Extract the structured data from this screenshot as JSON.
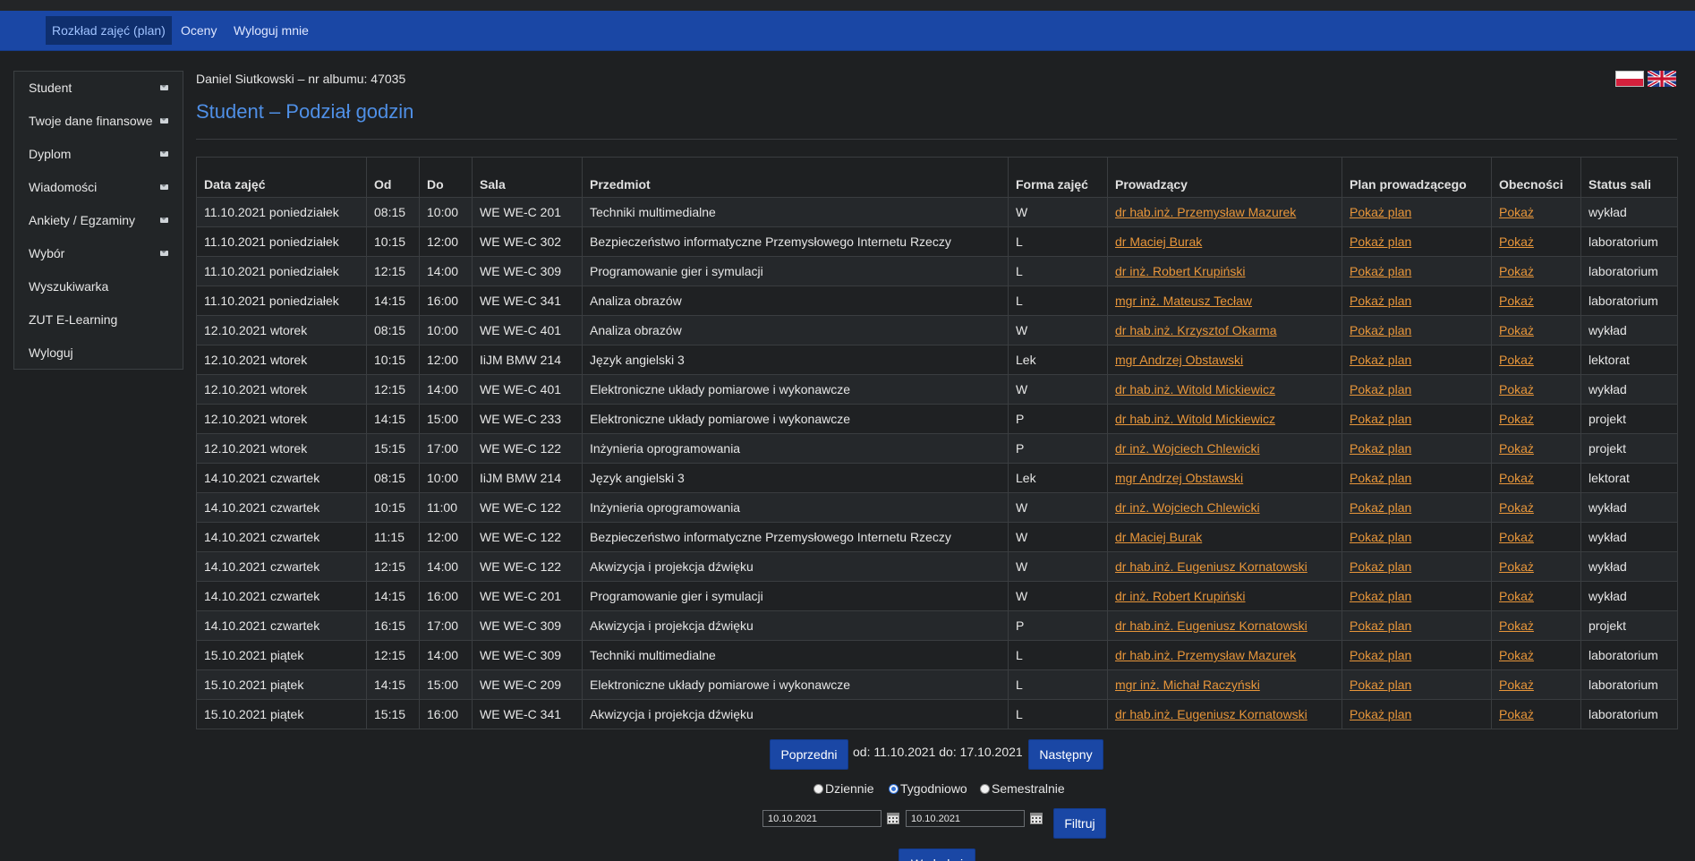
{
  "nav": {
    "items": [
      "Rozkład zajęć (plan)",
      "Oceny",
      "Wyloguj mnie"
    ]
  },
  "sidebar": {
    "items": [
      {
        "label": "Student",
        "icon": "envelope-icon"
      },
      {
        "label": "Twoje dane finansowe",
        "icon": "envelope-icon"
      },
      {
        "label": "Dyplom",
        "icon": "envelope-icon"
      },
      {
        "label": "Wiadomości",
        "icon": "envelope-icon"
      },
      {
        "label": "Ankiety / Egzaminy",
        "icon": "envelope-icon"
      },
      {
        "label": "Wybór",
        "icon": "envelope-icon"
      },
      {
        "label": "Wyszukiwarka"
      },
      {
        "label": "ZUT E-Learning"
      },
      {
        "label": "Wyloguj"
      }
    ]
  },
  "header": {
    "student_line": "Daniel Siutkowski – nr albumu: 47035",
    "title": "Student – Podział godzin"
  },
  "colors": {
    "navbar": "#1a47a5",
    "title": "#4f8fe6",
    "link": "#e8963a",
    "background": "#1e2022"
  },
  "table": {
    "headers": [
      "Data zajęć",
      "Od",
      "Do",
      "Sala",
      "Przedmiot",
      "Forma zajęć",
      "Prowadzący",
      "Plan prowadzącego",
      "Obecności",
      "Status sali"
    ],
    "plan_link_label": "Pokaż plan",
    "attendance_link_label": "Pokaż",
    "rows": [
      [
        "11.10.2021 poniedziałek",
        "08:15",
        "10:00",
        "WE WE-C 201",
        "Techniki multimedialne",
        "W",
        "dr hab.inż. Przemysław Mazurek",
        "wykład"
      ],
      [
        "11.10.2021 poniedziałek",
        "10:15",
        "12:00",
        "WE WE-C 302",
        "Bezpieczeństwo informatyczne Przemysłowego Internetu Rzeczy",
        "L",
        "dr Maciej Burak",
        "laboratorium"
      ],
      [
        "11.10.2021 poniedziałek",
        "12:15",
        "14:00",
        "WE WE-C 309",
        "Programowanie gier i symulacji",
        "L",
        "dr inż. Robert Krupiński",
        "laboratorium"
      ],
      [
        "11.10.2021 poniedziałek",
        "14:15",
        "16:00",
        "WE WE-C 341",
        "Analiza obrazów",
        "L",
        "mgr inż. Mateusz Tecław",
        "laboratorium"
      ],
      [
        "12.10.2021 wtorek",
        "08:15",
        "10:00",
        "WE WE-C 401",
        "Analiza obrazów",
        "W",
        "dr hab.inż. Krzysztof Okarma",
        "wykład"
      ],
      [
        "12.10.2021 wtorek",
        "10:15",
        "12:00",
        "IiJM BMW 214",
        "Język angielski 3",
        "Lek",
        "mgr Andrzej Obstawski",
        "lektorat"
      ],
      [
        "12.10.2021 wtorek",
        "12:15",
        "14:00",
        "WE WE-C 401",
        "Elektroniczne układy pomiarowe i wykonawcze",
        "W",
        "dr hab.inż. Witold Mickiewicz",
        "wykład"
      ],
      [
        "12.10.2021 wtorek",
        "14:15",
        "15:00",
        "WE WE-C 233",
        "Elektroniczne układy pomiarowe i wykonawcze",
        "P",
        "dr hab.inż. Witold Mickiewicz",
        "projekt"
      ],
      [
        "12.10.2021 wtorek",
        "15:15",
        "17:00",
        "WE WE-C 122",
        "Inżynieria oprogramowania",
        "P",
        "dr inż. Wojciech Chlewicki",
        "projekt"
      ],
      [
        "14.10.2021 czwartek",
        "08:15",
        "10:00",
        "IiJM BMW 214",
        "Język angielski 3",
        "Lek",
        "mgr Andrzej Obstawski",
        "lektorat"
      ],
      [
        "14.10.2021 czwartek",
        "10:15",
        "11:00",
        "WE WE-C 122",
        "Inżynieria oprogramowania",
        "W",
        "dr inż. Wojciech Chlewicki",
        "wykład"
      ],
      [
        "14.10.2021 czwartek",
        "11:15",
        "12:00",
        "WE WE-C 122",
        "Bezpieczeństwo informatyczne Przemysłowego Internetu Rzeczy",
        "W",
        "dr Maciej Burak",
        "wykład"
      ],
      [
        "14.10.2021 czwartek",
        "12:15",
        "14:00",
        "WE WE-C 122",
        "Akwizycja i projekcja dźwięku",
        "W",
        "dr hab.inż. Eugeniusz Kornatowski",
        "wykład"
      ],
      [
        "14.10.2021 czwartek",
        "14:15",
        "16:00",
        "WE WE-C 201",
        "Programowanie gier i symulacji",
        "W",
        "dr inż. Robert Krupiński",
        "wykład"
      ],
      [
        "14.10.2021 czwartek",
        "16:15",
        "17:00",
        "WE WE-C 309",
        "Akwizycja i projekcja dźwięku",
        "P",
        "dr hab.inż. Eugeniusz Kornatowski",
        "projekt"
      ],
      [
        "15.10.2021 piątek",
        "12:15",
        "14:00",
        "WE WE-C 309",
        "Techniki multimedialne",
        "L",
        "dr hab.inż. Przemysław Mazurek",
        "laboratorium"
      ],
      [
        "15.10.2021 piątek",
        "14:15",
        "15:00",
        "WE WE-C 209",
        "Elektroniczne układy pomiarowe i wykonawcze",
        "L",
        "mgr inż. Michał Raczyński",
        "laboratorium"
      ],
      [
        "15.10.2021 piątek",
        "15:15",
        "16:00",
        "WE WE-C 341",
        "Akwizycja i projekcja dźwięku",
        "L",
        "dr hab.inż. Eugeniusz Kornatowski",
        "laboratorium"
      ]
    ]
  },
  "pager": {
    "prev_label": "Poprzedni",
    "range_text": "od: 11.10.2021 do: 17.10.2021",
    "next_label": "Następny"
  },
  "view_mode": {
    "options": [
      "Dziennie",
      "Tygodniowo",
      "Semestralnie"
    ],
    "selected": "Tygodniowo"
  },
  "filter": {
    "date_from": "10.10.2021",
    "date_to": "10.10.2021",
    "button_label": "Filtruj"
  },
  "print_label": "Wydrukuj"
}
